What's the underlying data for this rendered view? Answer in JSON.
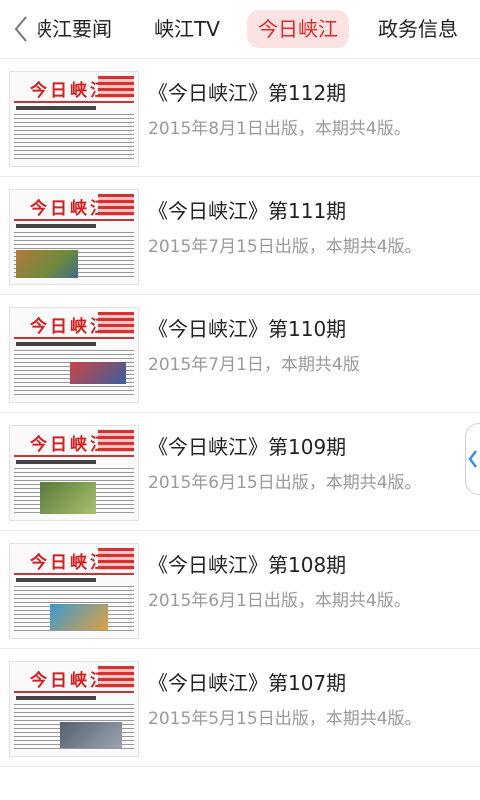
{
  "tabs": [
    {
      "label": "峡江要闻",
      "active": false
    },
    {
      "label": "峡江TV",
      "active": false
    },
    {
      "label": "今日峡江",
      "active": true
    },
    {
      "label": "政务信息",
      "active": false
    }
  ],
  "issues": [
    {
      "title": "《今日峡江》第112期",
      "meta": "2015年8月1日出版，本期共4版。",
      "thumb_masthead": "今日峡江"
    },
    {
      "title": "《今日峡江》第111期",
      "meta": "2015年7月15日出版，本期共4版。",
      "thumb_masthead": "今日峡江"
    },
    {
      "title": "《今日峡江》第110期",
      "meta": "2015年7月1日，本期共4版",
      "thumb_masthead": "今日峡江"
    },
    {
      "title": "《今日峡江》第109期",
      "meta": "2015年6月15日出版，本期共4版。",
      "thumb_masthead": "今日峡江"
    },
    {
      "title": "《今日峡江》第108期",
      "meta": "2015年6月1日出版，本期共4版。",
      "thumb_masthead": "今日峡江"
    },
    {
      "title": "《今日峡江》第107期",
      "meta": "2015年5月15日出版，本期共4版。",
      "thumb_masthead": "今日峡江"
    }
  ],
  "icons": {
    "back": "chevron-left-icon",
    "side_handle": "chevron-left-icon"
  },
  "colors": {
    "accent": "#e02a2a",
    "active_tab_bg": "#fbe3e4",
    "meta_text": "#9a9a9a"
  }
}
